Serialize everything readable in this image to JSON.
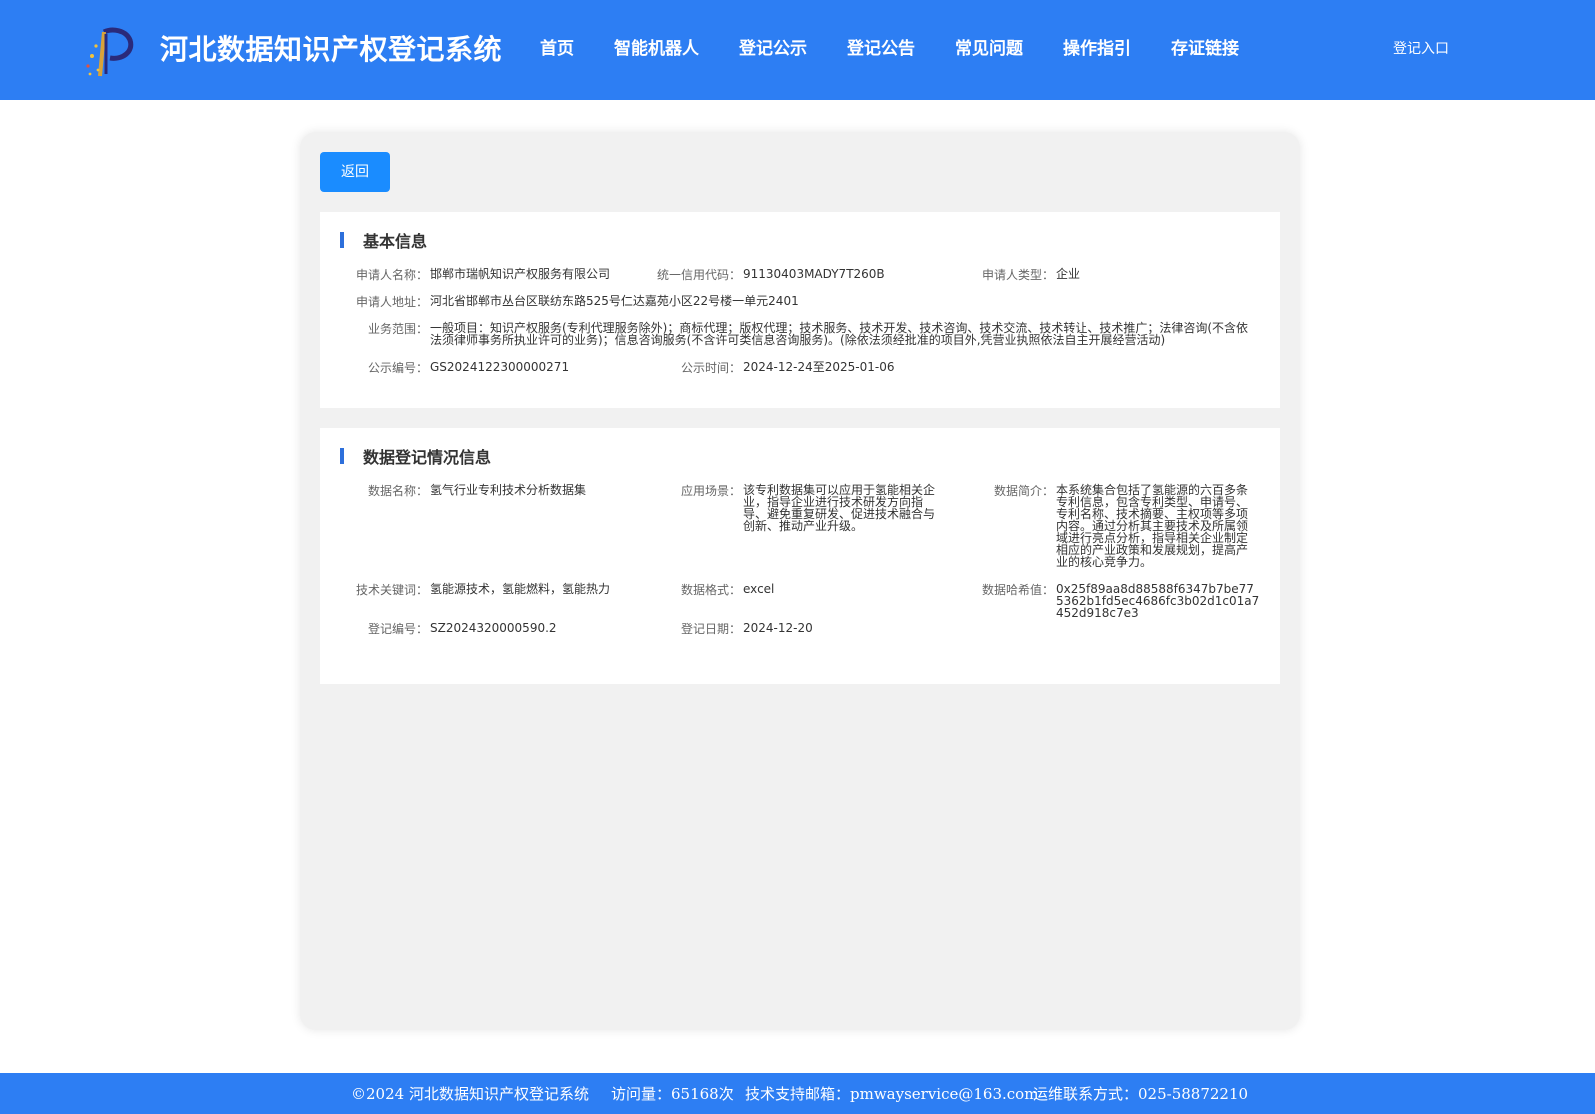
{
  "header": {
    "title": "河北数据知识产权登记系统",
    "nav": [
      "首页",
      "智能机器人",
      "登记公示",
      "登记公告",
      "常见问题",
      "操作指引",
      "存证链接"
    ],
    "login": "登记入口"
  },
  "back_label": "返回",
  "basic": {
    "title": "基本信息",
    "applicant_name_label": "申请人名称：",
    "applicant_name": "邯郸市瑞帆知识产权服务有限公司",
    "credit_code_label": "统一信用代码：",
    "credit_code": "91130403MADY7T260B",
    "applicant_type_label": "申请人类型：",
    "applicant_type": "企业",
    "address_label": "申请人地址：",
    "address": "河北省邯郸市丛台区联纺东路525号仁达嘉苑小区22号楼一单元2401",
    "scope_label": "业务范围：",
    "scope": "一般项目：知识产权服务(专利代理服务除外)；商标代理；版权代理；技术服务、技术开发、技术咨询、技术交流、技术转让、技术推广；法律咨询(不含依法须律师事务所执业许可的业务)；信息咨询服务(不含许可类信息咨询服务)。(除依法须经批准的项目外,凭营业执照依法自主开展经营活动)",
    "pub_no_label": "公示编号：",
    "pub_no": "GS2024122300000271",
    "pub_time_label": "公示时间：",
    "pub_time": "2024-12-24至2025-01-06"
  },
  "data": {
    "title": "数据登记情况信息",
    "name_label": "数据名称：",
    "name": "氢气行业专利技术分析数据集",
    "scene_label": "应用场景：",
    "scene": "该专利数据集可以应用于氢能相关企业，指导企业进行技术研发方向指导、避免重复研发、促进技术融合与创新、推动产业升级。",
    "intro_label": "数据简介：",
    "intro": "本系统集合包括了氢能源的六百多条专利信息，包含专利类型、申请号、专利名称、技术摘要、主权项等多项内容。通过分析其主要技术及所属领域进行亮点分析，指导相关企业制定相应的产业政策和发展规划，提高产业的核心竞争力。",
    "keywords_label": "技术关键词：",
    "keywords": "氢能源技术，氢能燃料，氢能热力",
    "format_label": "数据格式：",
    "format": "excel",
    "hash_label": "数据哈希值：",
    "hash": "0x25f89aa8d88588f6347b7be775362b1fd5ec4686fc3b02d1c01a7452d918c7e3",
    "reg_no_label": "登记编号：",
    "reg_no": "SZ2024320000590.2",
    "reg_date_label": "登记日期：",
    "reg_date": "2024-12-20"
  },
  "footer": {
    "copyright": "©2024 河北数据知识产权登记系统",
    "visits": "访问量：65168次",
    "email": "技术支持邮箱：pmwayservice@163.com",
    "phone": "运维联系方式：025-58872210"
  },
  "colors": {
    "header_bg": "#2d7ef3",
    "button_bg": "#1a8cff",
    "panel_bg": "#f1f1f1",
    "title_bar": "#2d6fdb"
  }
}
